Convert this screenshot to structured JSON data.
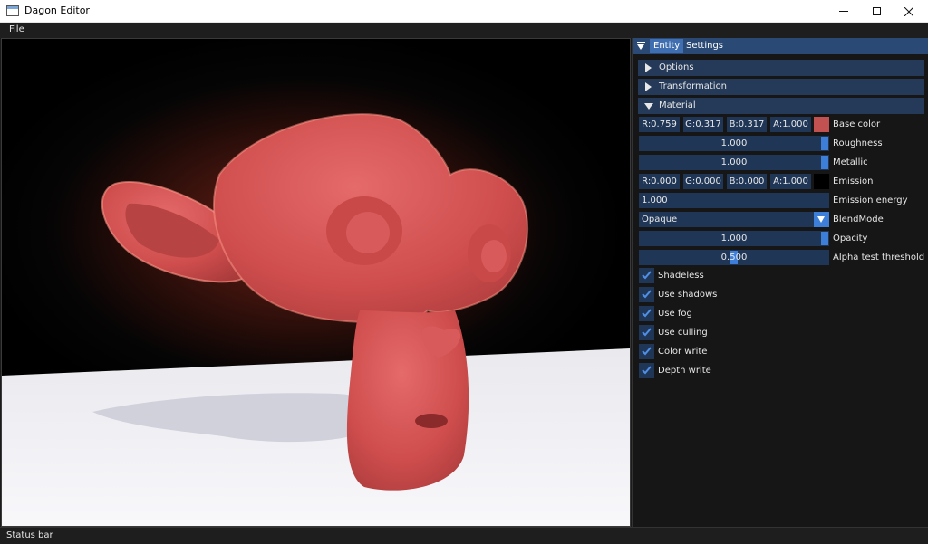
{
  "window": {
    "title": "Dagon Editor"
  },
  "menu": {
    "file": "File"
  },
  "panel": {
    "tabs": [
      "Entity",
      "Settings"
    ],
    "sections": {
      "options": "Options",
      "transformation": "Transformation",
      "material": "Material"
    }
  },
  "material": {
    "base_color": {
      "r": "R:0.759",
      "g": "G:0.317",
      "b": "B:0.317",
      "a": "A:1.000",
      "label": "Base color",
      "swatch": "#c25151"
    },
    "roughness": {
      "value": "1.000",
      "label": "Roughness",
      "fraction": 1.0
    },
    "metallic": {
      "value": "1.000",
      "label": "Metallic",
      "fraction": 1.0
    },
    "emission": {
      "r": "R:0.000",
      "g": "G:0.000",
      "b": "B:0.000",
      "a": "A:1.000",
      "label": "Emission",
      "swatch": "#000000"
    },
    "emission_energy": {
      "value": "1.000",
      "label": "Emission energy"
    },
    "blend_mode": {
      "value": "Opaque",
      "label": "BlendMode"
    },
    "opacity": {
      "value": "1.000",
      "label": "Opacity",
      "fraction": 1.0
    },
    "alpha_test": {
      "value": "0.500",
      "label": "Alpha test threshold",
      "fraction": 0.5
    },
    "checkboxes": [
      {
        "label": "Shadeless",
        "checked": true
      },
      {
        "label": "Use shadows",
        "checked": true
      },
      {
        "label": "Use fog",
        "checked": true
      },
      {
        "label": "Use culling",
        "checked": true
      },
      {
        "label": "Color write",
        "checked": true
      },
      {
        "label": "Depth write",
        "checked": true
      }
    ]
  },
  "status": {
    "text": "Status bar"
  },
  "colors": {
    "accent": "#3d7fd8",
    "header": "#253a58",
    "field": "#1f3656",
    "tab_active": "#3f6fb0",
    "tabbar": "#2a4a75"
  }
}
